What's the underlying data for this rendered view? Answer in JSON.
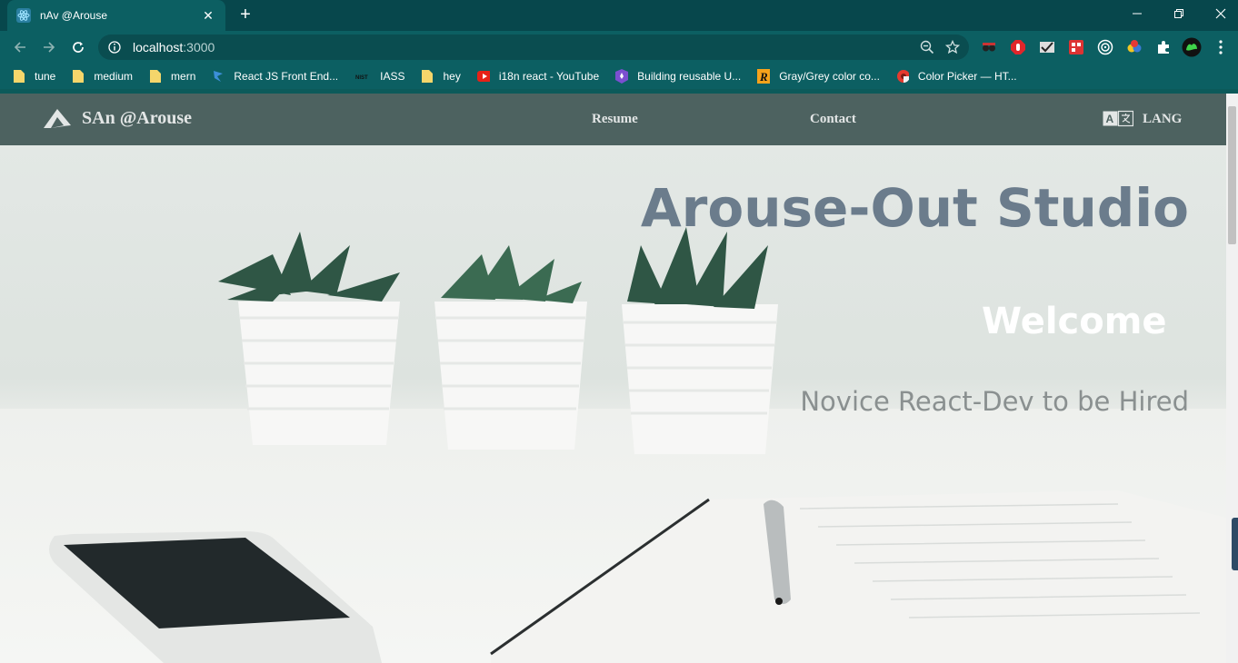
{
  "browser": {
    "tab": {
      "title": "nAv @Arouse",
      "favicon": "react-icon"
    },
    "address": {
      "host": "localhost",
      "port": ":3000"
    },
    "bookmarks": [
      {
        "label": "tune",
        "icon": "folder-icon"
      },
      {
        "label": "medium",
        "icon": "folder-icon"
      },
      {
        "label": "mern",
        "icon": "folder-icon"
      },
      {
        "label": "React JS Front End...",
        "icon": "bookmark-site-icon"
      },
      {
        "label": "IASS",
        "icon": "nist-icon"
      },
      {
        "label": "hey",
        "icon": "folder-icon"
      },
      {
        "label": "i18n react - YouTube",
        "icon": "youtube-icon"
      },
      {
        "label": "Building reusable U...",
        "icon": "rocket-icon"
      },
      {
        "label": "Gray/Grey color co...",
        "icon": "r-logo-icon"
      },
      {
        "label": "Color Picker — HT...",
        "icon": "color-picker-icon"
      }
    ]
  },
  "site": {
    "brand": "SAn @Arouse",
    "nav": {
      "resume": "Resume",
      "contact": "Contact",
      "lang": "LANG"
    },
    "hero": {
      "title": "Arouse-Out Studio",
      "welcome": "Welcome",
      "subtitle": "Novice React-Dev to be Hired"
    }
  },
  "colors": {
    "chrome_dark": "#07474c",
    "chrome": "#0c5f62",
    "site_nav": "#4d6260",
    "hero_title": "#6b7c8c",
    "hero_sub": "#8a9090"
  }
}
